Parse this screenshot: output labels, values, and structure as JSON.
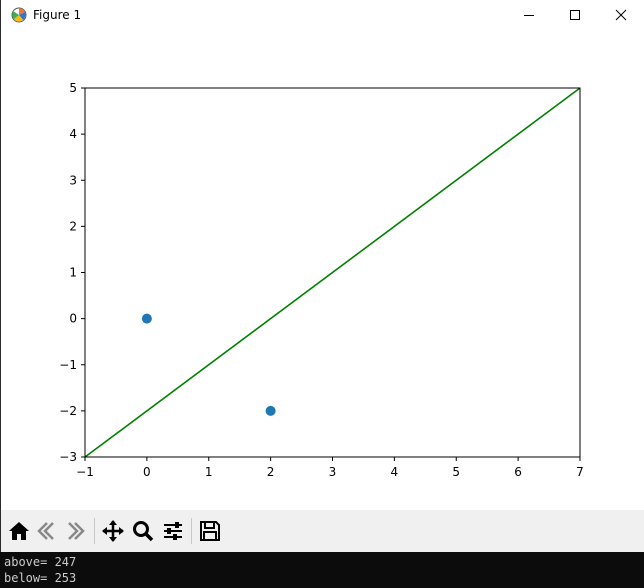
{
  "window": {
    "title": "Figure 1"
  },
  "icons": {
    "app": "matplotlib-figure-icon",
    "minimize": "minimize-icon",
    "maximize": "maximize-icon",
    "close": "close-icon"
  },
  "chart_data": {
    "type": "scatter",
    "title": "",
    "xlabel": "",
    "ylabel": "",
    "xlim": [
      -1,
      7
    ],
    "ylim": [
      -3,
      5
    ],
    "xticks": [
      -1,
      0,
      1,
      2,
      3,
      4,
      5,
      6,
      7
    ],
    "yticks": [
      -3,
      -2,
      -1,
      0,
      1,
      2,
      3,
      4,
      5
    ],
    "grid": false,
    "series": [
      {
        "kind": "scatter",
        "color": "#1f77b4",
        "points": [
          {
            "x": 0,
            "y": 0
          },
          {
            "x": 2,
            "y": -2
          }
        ]
      },
      {
        "kind": "line",
        "color": "#008000",
        "points": [
          {
            "x": -1,
            "y": -3
          },
          {
            "x": 7,
            "y": 5
          }
        ]
      }
    ]
  },
  "toolbar": {
    "buttons": [
      {
        "name": "home-icon"
      },
      {
        "name": "back-icon"
      },
      {
        "name": "forward-icon"
      },
      {
        "name": "pan-icon"
      },
      {
        "name": "zoom-icon"
      },
      {
        "name": "configure-subplots-icon"
      },
      {
        "name": "save-icon"
      }
    ]
  },
  "console": {
    "lines": [
      "above= 247",
      "below= 253"
    ]
  }
}
